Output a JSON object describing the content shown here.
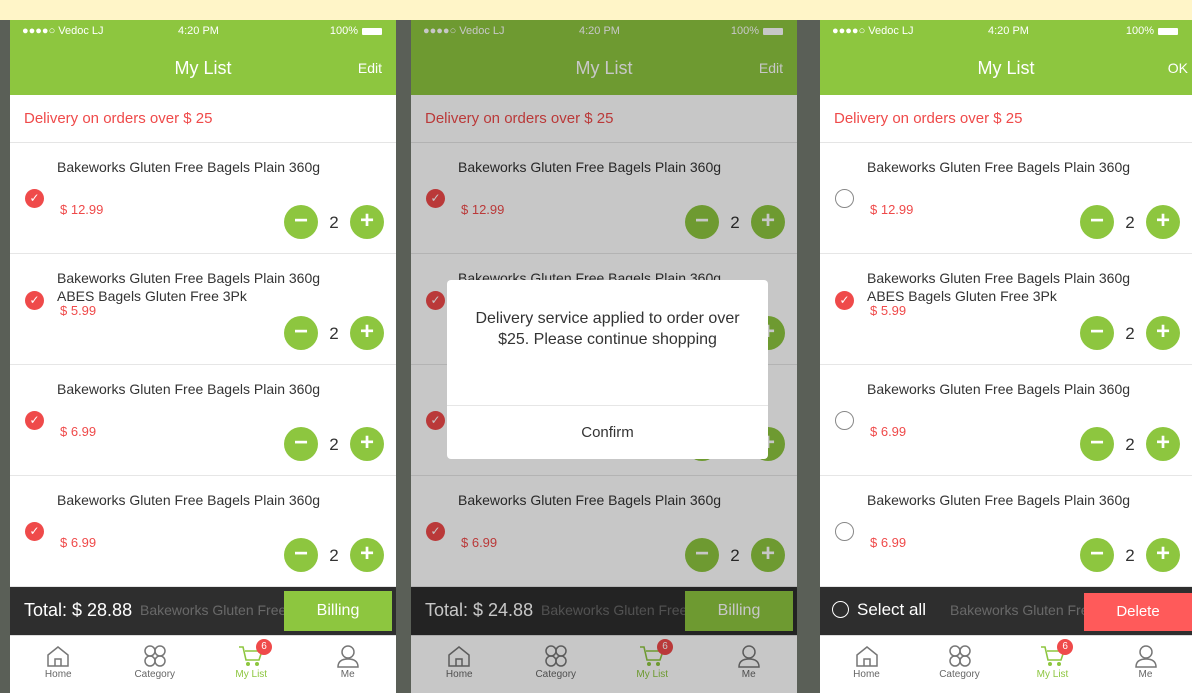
{
  "status": {
    "carrier": "●●●●○ Vedoc LJ",
    "time": "4:20 PM",
    "battery": "100%"
  },
  "accent_color": "#8dc63f",
  "price_color": "#ef4a4a",
  "screen1": {
    "title": "My List",
    "action": "Edit",
    "notice": "Delivery on orders over $ 25",
    "items": [
      {
        "name": "Bakeworks Gluten Free Bagels Plain 360g",
        "price": "$ 12.99",
        "qty": "2",
        "checked": true
      },
      {
        "name": "Bakeworks Gluten Free Bagels Plain 360g",
        "name2": "ABES Bagels Gluten Free 3Pk",
        "price": "$ 5.99",
        "qty": "2",
        "checked": true
      },
      {
        "name": "Bakeworks Gluten Free Bagels Plain 360g",
        "price": "$ 6.99",
        "qty": "2",
        "checked": true
      },
      {
        "name": "Bakeworks Gluten Free Bagels Plain 360g",
        "price": "$ 6.99",
        "qty": "2",
        "checked": true
      }
    ],
    "ghost": "Bakeworks Gluten Free Bagels",
    "total": "Total:  $ 28.88",
    "billing": "Billing"
  },
  "screen2": {
    "title": "My List",
    "action": "Edit",
    "notice": "Delivery on orders over $ 25",
    "items": [
      {
        "name": "Bakeworks Gluten Free Bagels Plain 360g",
        "price": "$ 12.99",
        "qty": "2"
      },
      {
        "name": "Bakeworks Gluten Free Bagels Plain 360g",
        "price": "",
        "qty": "2"
      },
      {
        "name": "",
        "price": "",
        "qty": "2"
      },
      {
        "name": "Bakeworks Gluten Free Bagels Plain 360g",
        "price": "$ 6.99",
        "qty": "2"
      }
    ],
    "ghost": "Bakeworks Gluten Free Bagels",
    "total": "Total:  $ 24.88",
    "billing": "Billing",
    "dialog": {
      "message": "Delivery service applied to order over $25. Please continue shopping",
      "confirm": "Confirm"
    }
  },
  "screen3": {
    "title": "My List",
    "action": "OK",
    "notice": "Delivery on orders over $ 25",
    "items": [
      {
        "name": "Bakeworks Gluten Free Bagels Plain 360g",
        "price": "$ 12.99",
        "qty": "2",
        "checked": false
      },
      {
        "name": "Bakeworks Gluten Free Bagels Plain 360g",
        "name2": "ABES Bagels Gluten Free 3Pk",
        "price": "$ 5.99",
        "qty": "2",
        "checked": true
      },
      {
        "name": "Bakeworks Gluten Free Bagels Plain 360g",
        "price": "$ 6.99",
        "qty": "2",
        "checked": false
      },
      {
        "name": "Bakeworks Gluten Free Bagels Plain 360g",
        "price": "$ 6.99",
        "qty": "2",
        "checked": false
      }
    ],
    "ghost": "Bakeworks Gluten Free Bagels",
    "select_all": "Select all",
    "delete": "Delete"
  },
  "tabs": [
    {
      "label": "Home",
      "icon": "home-icon"
    },
    {
      "label": "Category",
      "icon": "category-icon"
    },
    {
      "label": "My List",
      "icon": "cart-icon",
      "badge": "6",
      "active": true
    },
    {
      "label": "Me",
      "icon": "person-icon"
    }
  ]
}
